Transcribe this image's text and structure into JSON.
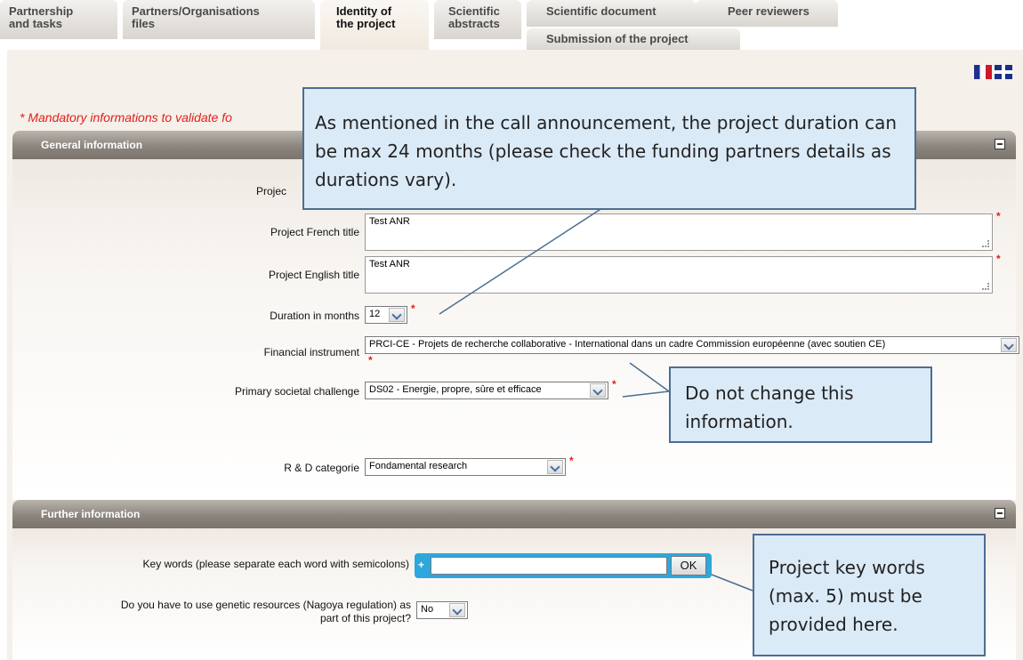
{
  "tabs": [
    {
      "line1": "Partnership",
      "line2": "and tasks"
    },
    {
      "line1": "Partners/Organisations",
      "line2": "files"
    },
    {
      "line1": "Identity of",
      "line2": "the project"
    },
    {
      "line1": "Scientific",
      "line2": "abstracts"
    },
    {
      "line1": "Scientific document",
      "line2": ""
    },
    {
      "line1": "Peer reviewers",
      "line2": ""
    },
    {
      "line1": "Submission of the project",
      "line2": ""
    }
  ],
  "mandatory_text": "* Mandatory informations to validate fo",
  "sections": {
    "general": {
      "title": "General information"
    },
    "further": {
      "title": "Further information"
    }
  },
  "fields": {
    "acronym_label_partial": "Projec",
    "french_title": {
      "label": "Project French title",
      "value": "Test ANR"
    },
    "english_title": {
      "label": "Project English title",
      "value": "Test ANR"
    },
    "duration": {
      "label": "Duration in months",
      "value": "12"
    },
    "financial_instrument": {
      "label": "Financial instrument",
      "value": "PRCI-CE - Projets de recherche collaborative - International dans un cadre Commission européenne (avec soutien CE)"
    },
    "societal_challenge": {
      "label": "Primary societal challenge",
      "value": "DS02 - Energie, propre, sûre et efficace"
    },
    "rd_category": {
      "label": "R & D categorie",
      "value": "Fondamental research"
    },
    "keywords": {
      "label": "Key words (please separate each word with semicolons)",
      "plus": "+",
      "ok_label": "OK"
    },
    "genetic_resources": {
      "label_line1": "Do you have to use genetic resources (Nagoya regulation) as",
      "label_line2": "part of this project?",
      "value": "No"
    }
  },
  "required_marker": "*",
  "callouts": {
    "duration_note": "As mentioned in the call announcement, the project duration can be max 24 months (please check the funding partners details as durations vary).",
    "no_change_note": "Do not change this information.",
    "keywords_note": "Project key words (max. 5) must be provided here."
  },
  "languages": [
    "fr-flag-icon",
    "uk-flag-icon"
  ]
}
